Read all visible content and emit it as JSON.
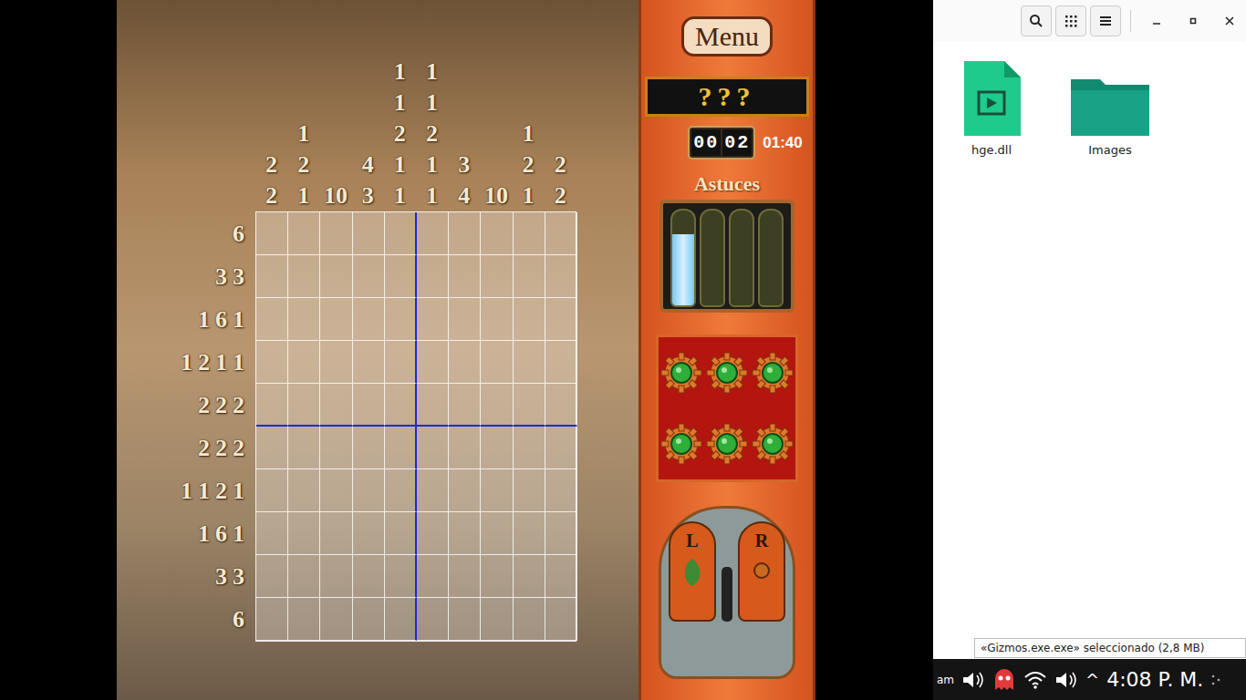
{
  "game": {
    "column_clues": [
      [
        "2",
        "2"
      ],
      [
        "1",
        "2",
        "1"
      ],
      [
        "10"
      ],
      [
        "4",
        "3"
      ],
      [
        "1",
        "1",
        "2",
        "1",
        "1"
      ],
      [
        "1",
        "1",
        "2",
        "1",
        "1"
      ],
      [
        "3",
        "4"
      ],
      [
        "10"
      ],
      [
        "1",
        "2",
        "1"
      ],
      [
        "2",
        "2"
      ]
    ],
    "row_clues": [
      [
        "6"
      ],
      [
        "3",
        "3"
      ],
      [
        "1",
        "6",
        "1"
      ],
      [
        "1",
        "2",
        "1",
        "1"
      ],
      [
        "2",
        "2",
        "2"
      ],
      [
        "2",
        "2",
        "2"
      ],
      [
        "1",
        "1",
        "2",
        "1"
      ],
      [
        "1",
        "6",
        "1"
      ],
      [
        "3",
        "3"
      ],
      [
        "6"
      ]
    ],
    "cells": [
      [
        false,
        false,
        false,
        false,
        false,
        false,
        false,
        false,
        false,
        false
      ],
      [
        false,
        false,
        false,
        false,
        false,
        false,
        false,
        false,
        false,
        false
      ],
      [
        false,
        false,
        false,
        false,
        false,
        false,
        false,
        false,
        false,
        false
      ],
      [
        false,
        false,
        false,
        false,
        false,
        false,
        false,
        false,
        false,
        false
      ],
      [
        false,
        false,
        false,
        false,
        false,
        false,
        false,
        false,
        false,
        false
      ],
      [
        false,
        false,
        false,
        false,
        false,
        false,
        false,
        false,
        false,
        false
      ],
      [
        false,
        false,
        false,
        false,
        false,
        false,
        false,
        false,
        false,
        false
      ],
      [
        false,
        false,
        false,
        false,
        false,
        false,
        false,
        false,
        false,
        false
      ],
      [
        false,
        false,
        false,
        false,
        false,
        false,
        false,
        false,
        false,
        false
      ],
      [
        false,
        false,
        false,
        false,
        false,
        false,
        false,
        false,
        false,
        false
      ]
    ]
  },
  "panel": {
    "menu_button": "Menu",
    "mystery": "???",
    "timer": {
      "minutes": "00",
      "seconds": "02"
    },
    "time_limit": "01:40",
    "hints_title": "Astuces",
    "hint_vials": [
      {
        "level": 0.75
      },
      {
        "level": 0
      },
      {
        "level": 0
      },
      {
        "level": 0
      }
    ],
    "gems": [
      {
        "active": true
      },
      {
        "active": true
      },
      {
        "active": true
      },
      {
        "active": true
      },
      {
        "active": true
      },
      {
        "active": true
      }
    ],
    "mouse": {
      "left": "L",
      "right": "R"
    }
  },
  "file_manager": {
    "files": [
      {
        "name": "hge.dll",
        "kind": "video"
      },
      {
        "name": "Images",
        "kind": "folder"
      }
    ],
    "tooltip": "«Gizmos.exe.exe» seleccionado (2,8 MB)"
  },
  "taskbar": {
    "cut_label": "am",
    "chevron": "^",
    "clock": "4:08 P. M."
  }
}
